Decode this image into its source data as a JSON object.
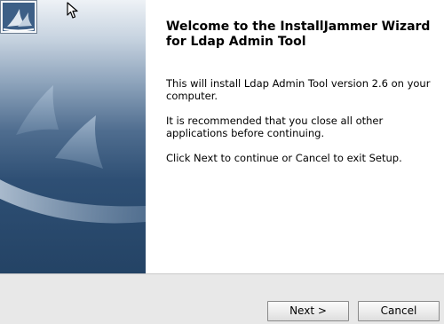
{
  "wizard": {
    "title": "Welcome to the InstallJammer Wizard for Ldap Admin Tool",
    "paragraphs": [
      "This will install Ldap Admin Tool version 2.6 on your computer.",
      "It is recommended that you close all other applications before  continuing.",
      "Click Next to continue or Cancel to exit Setup."
    ]
  },
  "buttons": {
    "next_label": "Next >",
    "cancel_label": "Cancel"
  },
  "colors": {
    "side_panel_top": "#eef2f6",
    "side_panel_bottom": "#244365",
    "button_bar": "#e8e8e8"
  },
  "icons": [
    "installjammer-logo-icon",
    "mouse-cursor-icon"
  ]
}
